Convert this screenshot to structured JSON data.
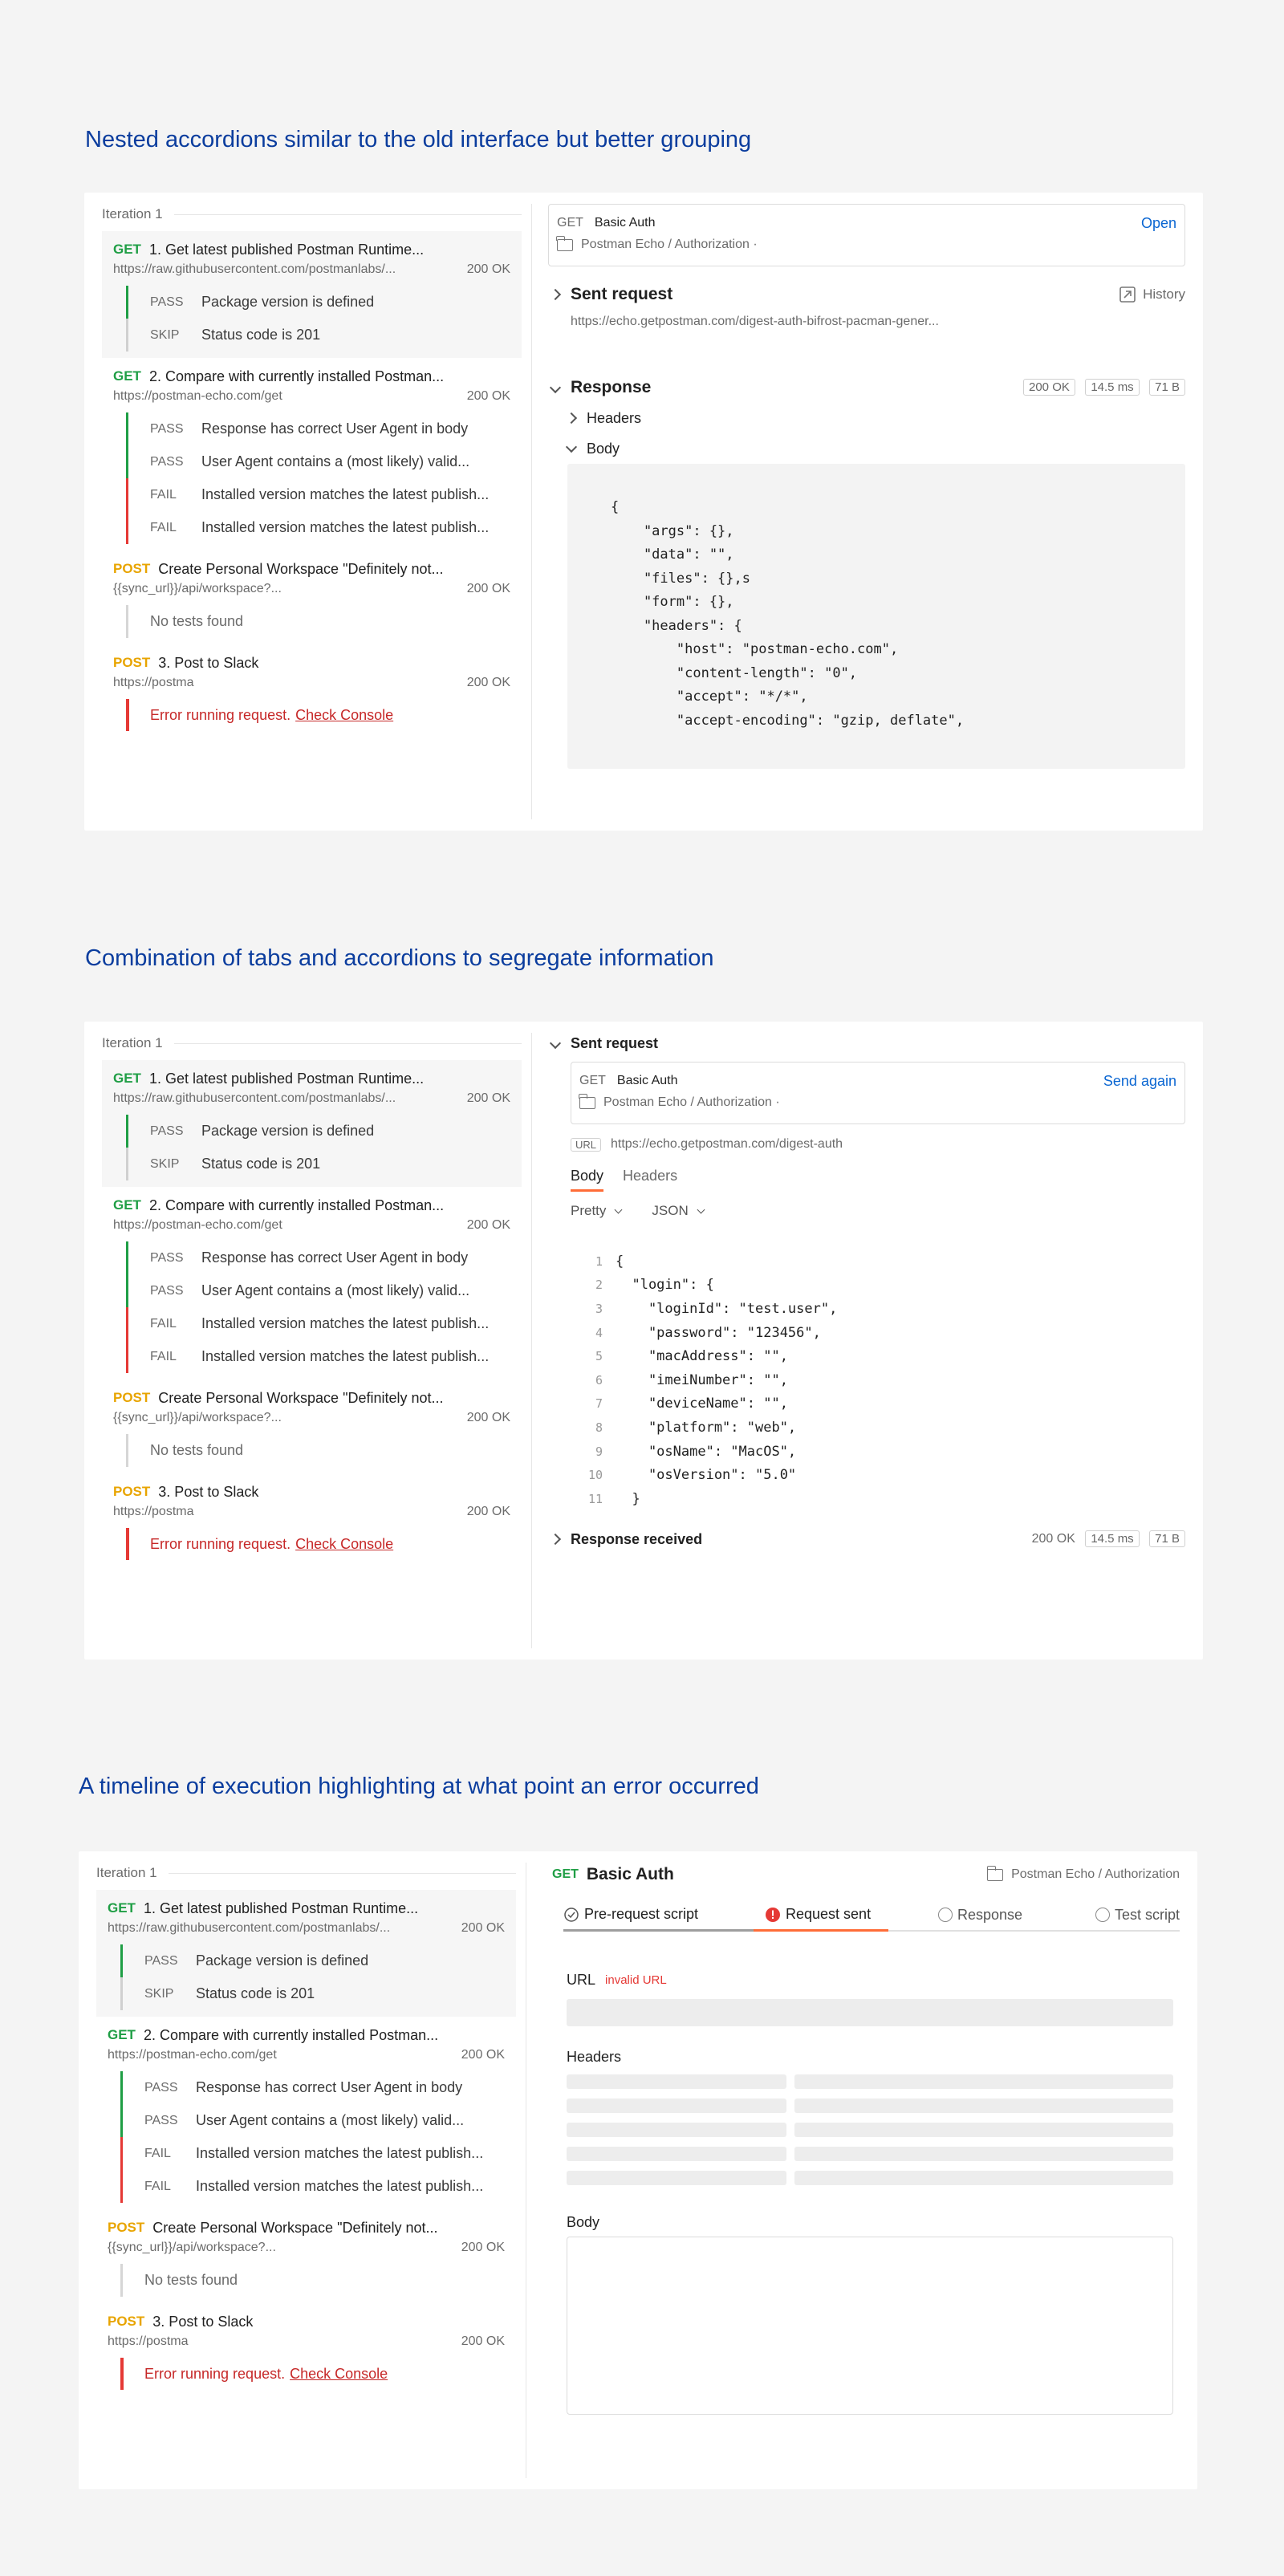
{
  "headings": {
    "one": "Nested accordions similar to the old interface but better grouping",
    "two": "Combination of tabs and accordions to segregate information",
    "three": "A timeline of execution highlighting at what point an error occurred"
  },
  "run": {
    "iteration": "Iteration 1",
    "requests": [
      {
        "method": "GET",
        "name": "1. Get latest published Postman Runtime...",
        "url": "https://raw.githubusercontent.com/postmanlabs/...",
        "status": "200 OK",
        "tests": [
          {
            "tag": "PASS",
            "text": "Package version is defined"
          },
          {
            "tag": "SKIP",
            "text": "Status code is 201"
          }
        ]
      },
      {
        "method": "GET",
        "name": "2. Compare with currently installed Postman...",
        "url": "https://postman-echo.com/get",
        "status": "200 OK",
        "tests": [
          {
            "tag": "PASS",
            "text": "Response has correct User Agent in body"
          },
          {
            "tag": "PASS",
            "text": "User Agent contains a (most likely) valid..."
          },
          {
            "tag": "FAIL",
            "text": "Installed version matches the latest publish..."
          },
          {
            "tag": "FAIL",
            "text": "Installed version matches the latest publish..."
          }
        ]
      },
      {
        "method": "POST",
        "name": "Create Personal Workspace \"Definitely not...",
        "url": "{{sync_url}}/api/workspace?...",
        "status": "200 OK",
        "no_tests": "No tests found"
      },
      {
        "method": "POST",
        "name": "3. Post to Slack",
        "url": "https://postma",
        "status": "200 OK",
        "error": "Error running request.",
        "error_link": "Check Console"
      }
    ]
  },
  "panel1": {
    "method": "GET",
    "title": "Basic Auth",
    "open": "Open",
    "path": "Postman Echo / Authorization ·",
    "sent_request": "Sent request",
    "history": "History",
    "sent_url": "https://echo.getpostman.com/digest-auth-bifrost-pacman-gener...",
    "response": "Response",
    "status": "200 OK",
    "time": "14.5 ms",
    "size": "71 B",
    "headers": "Headers",
    "body": "Body",
    "code": [
      "{",
      "    \"args\": {},",
      "    \"data\": \"\",",
      "    \"files\": {},s",
      "    \"form\": {},",
      "    \"headers\": {",
      "        \"host\": \"postman-echo.com\",",
      "        \"content-length\": \"0\",",
      "        \"accept\": \"*/*\",",
      "        \"accept-encoding\": \"gzip, deflate\","
    ]
  },
  "panel2": {
    "sent_request": "Sent request",
    "method": "GET",
    "title": "Basic Auth",
    "send_again": "Send again",
    "path": "Postman Echo / Authorization ·",
    "url_tag": "URL",
    "url": "https://echo.getpostman.com/digest-auth",
    "tab_body": "Body",
    "tab_headers": "Headers",
    "pretty": "Pretty",
    "json": "JSON",
    "lines": [
      {
        "n": "1",
        "t": "{"
      },
      {
        "n": "2",
        "t": "  \"login\": {"
      },
      {
        "n": "3",
        "t": "    \"loginId\": \"test.user\","
      },
      {
        "n": "4",
        "t": "    \"password\": \"123456\","
      },
      {
        "n": "5",
        "t": "    \"macAddress\": \"\","
      },
      {
        "n": "6",
        "t": "    \"imeiNumber\": \"\","
      },
      {
        "n": "7",
        "t": "    \"deviceName\": \"\","
      },
      {
        "n": "8",
        "t": "    \"platform\": \"web\","
      },
      {
        "n": "9",
        "t": "    \"osName\": \"MacOS\","
      },
      {
        "n": "10",
        "t": "    \"osVersion\": \"5.0\""
      },
      {
        "n": "11",
        "t": "  }"
      }
    ],
    "response_received": "Response received",
    "status": "200 OK",
    "time": "14.5 ms",
    "size": "71 B"
  },
  "panel3": {
    "method": "GET",
    "title": "Basic Auth",
    "path": "Postman Echo / Authorization",
    "tabs": [
      "Pre-request script",
      "Request sent",
      "Response",
      "Test script"
    ],
    "url_label": "URL",
    "url_error": "invalid URL",
    "headers": "Headers",
    "body": "Body",
    "colors": {
      "error": "#e53935",
      "active_tab": "#ff6c37"
    }
  }
}
